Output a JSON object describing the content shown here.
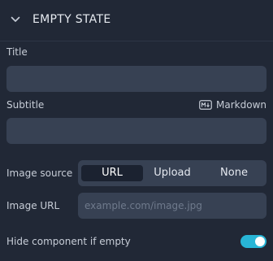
{
  "section": {
    "title": "EMPTY STATE",
    "chevron_icon": "chevron-down-icon"
  },
  "fields": {
    "title_label": "Title",
    "title_value": "",
    "subtitle_label": "Subtitle",
    "subtitle_value": "",
    "markdown_hint": "Markdown",
    "markdown_icon": "markdown-icon"
  },
  "image_source": {
    "label": "Image source",
    "options": [
      "URL",
      "Upload",
      "None"
    ],
    "selected": "URL"
  },
  "image_url": {
    "label": "Image URL",
    "value": "",
    "placeholder": "example.com/image.jpg"
  },
  "hide_if_empty": {
    "label": "Hide component if empty",
    "enabled": true
  },
  "colors": {
    "background": "#212836",
    "input": "#374153",
    "accent": "#28b5d6"
  }
}
